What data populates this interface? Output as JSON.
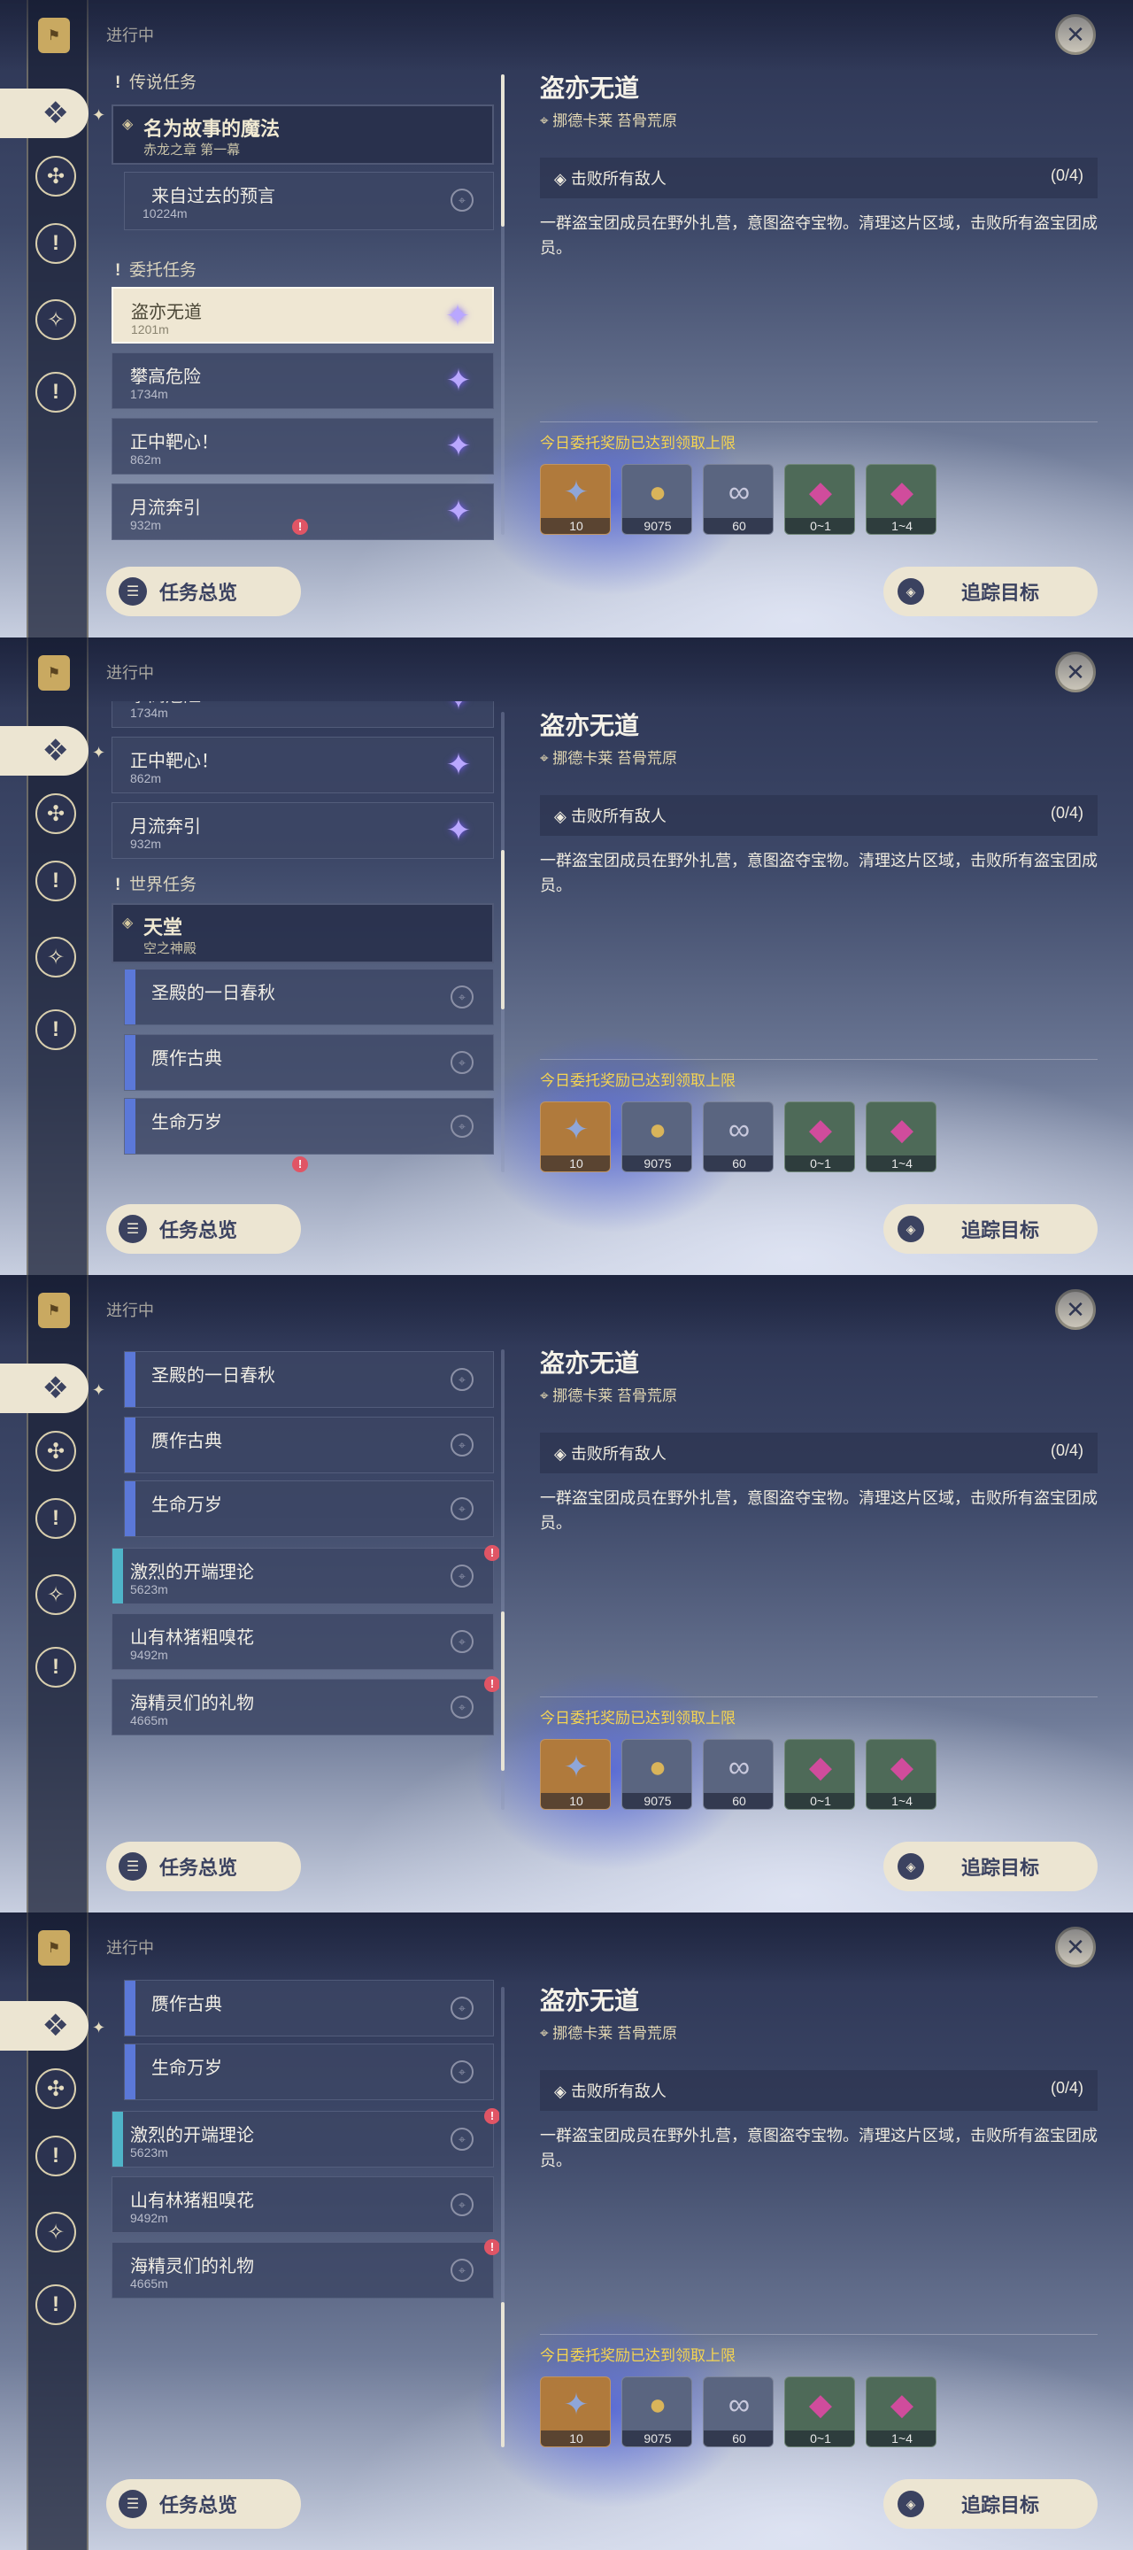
{
  "header": {
    "in_progress": "进行中"
  },
  "rail_icons": [
    "flag-icon",
    "commission-icon",
    "archon-quest-icon",
    "exclamation-icon",
    "world-quest-icon",
    "exclamation-icon"
  ],
  "sections": {
    "legend": "传说任务",
    "commission": "委托任务",
    "world": "世界任务"
  },
  "quests": {
    "legend_head": {
      "title": "名为故事的魔法",
      "sub": "赤龙之章 第一幕"
    },
    "legend_sub": {
      "title": "来自过去的预言",
      "dist": "10224m"
    },
    "c1": {
      "title": "盗亦无道",
      "dist": "1201m"
    },
    "c2": {
      "title": "攀高危险",
      "dist": "1734m"
    },
    "c3": {
      "title": "正中靶心！",
      "dist": "862m"
    },
    "c4": {
      "title": "月流奔引",
      "dist": "932m"
    },
    "world_head": {
      "title": "天堂",
      "sub": "空之神殿"
    },
    "w1": {
      "title": "圣殿的一日春秋"
    },
    "w2": {
      "title": "赝作古典"
    },
    "w3": {
      "title": "生命万岁"
    },
    "q1": {
      "title": "激烈的开端理论",
      "dist": "5623m"
    },
    "q2": {
      "title": "山有林猪粗嗅花",
      "dist": "9492m"
    },
    "q3": {
      "title": "海精灵们的礼物",
      "dist": "4665m"
    }
  },
  "buttons": {
    "overview": "任务总览",
    "track": "追踪目标"
  },
  "detail": {
    "title": "盗亦无道",
    "location": "挪德卡莱 苔骨荒原",
    "objective": "击败所有敌人",
    "progress": "(0/4)",
    "description": "一群盗宝团成员在野外扎营，意图盗夺宝物。清理这片区域，击败所有盗宝团成员。",
    "reward_limit": "今日委托奖励已达到领取上限",
    "rewards": [
      {
        "name": "adventure-exp",
        "qty": "10",
        "bg": "#b07a3c",
        "glyph": "✦",
        "color": "#8fa6d8"
      },
      {
        "name": "mora",
        "qty": "9075",
        "bg": "#5a6580",
        "glyph": "●",
        "color": "#d9b45a"
      },
      {
        "name": "friendship-exp",
        "qty": "60",
        "bg": "#5a6580",
        "glyph": "∞",
        "color": "#c9c9dd"
      },
      {
        "name": "gem-1",
        "qty": "0~1",
        "bg": "#4e6a58",
        "glyph": "◆",
        "color": "#d04c9c"
      },
      {
        "name": "gem-2",
        "qty": "1~4",
        "bg": "#4e6a58",
        "glyph": "◆",
        "color": "#d04c9c"
      }
    ]
  }
}
